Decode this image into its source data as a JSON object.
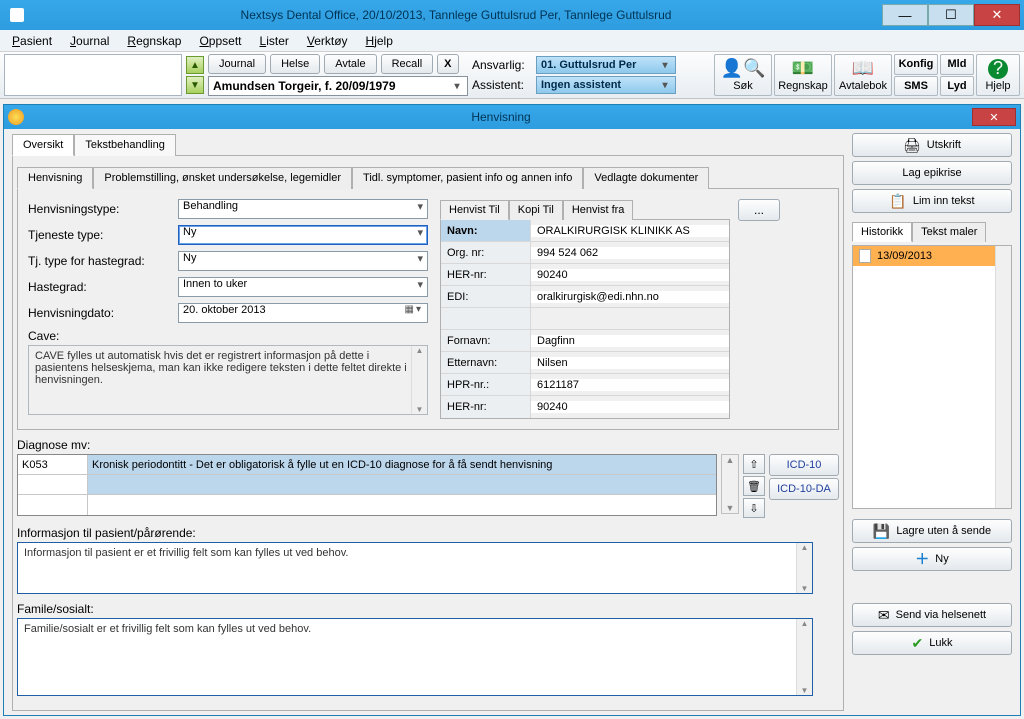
{
  "titlebar": {
    "text": "Nextsys Dental Office,  20/10/2013, Tannlege Guttulsrud Per,  Tannlege Guttulsrud"
  },
  "menubar": {
    "items": [
      "Pasient",
      "Journal",
      "Regnskap",
      "Oppsett",
      "Lister",
      "Verktøy",
      "Hjelp"
    ]
  },
  "toolbar": {
    "buttons": {
      "journal": "Journal",
      "helse": "Helse",
      "avtale": "Avtale",
      "recall": "Recall",
      "x": "X"
    },
    "patient": "Amundsen Torgeir, f. 20/09/1979",
    "ansvarlig_lbl": "Ansvarlig:",
    "ansvarlig": "01. Guttulsrud Per",
    "assistent_lbl": "Assistent:",
    "assistent": "Ingen assistent",
    "big": {
      "sok": "Søk",
      "regnskap": "Regnskap",
      "avtalebok": "Avtalebok",
      "hjelp": "Hjelp"
    },
    "twin": {
      "konfig": "Konfig",
      "sms": "SMS",
      "mld": "Mld",
      "lyd": "Lyd"
    }
  },
  "sub": {
    "title": "Henvisning",
    "tabs1": {
      "oversikt": "Oversikt",
      "tekst": "Tekstbehandling"
    },
    "tabs2": {
      "t1": "Henvisning",
      "t2": "Problemstilling, ønsket undersøkelse, legemidler",
      "t3": "Tidl. symptomer, pasient info og annen info",
      "t4": "Vedlagte dokumenter"
    },
    "form": {
      "henvisningstype_lbl": "Henvisningstype:",
      "henvisningstype": "Behandling",
      "tjeneste_lbl": "Tjeneste type:",
      "tjeneste": "Ny",
      "haste_lbl": "Tj. type for hastegrad:",
      "haste": "Ny",
      "hastegrad_lbl": "Hastegrad:",
      "hastegrad": "Innen to uker",
      "dato_lbl": "Henvisningdato:",
      "dato": "20.   oktober   2013",
      "cave_lbl": "Cave:",
      "cave_text": "CAVE fylles ut automatisk hvis det er registrert informasjon på dette i pasientens helseskjema, man kan ikke redigere teksten i dette feltet direkte i henvisningen."
    },
    "recip": {
      "tabs": {
        "til": "Henvist Til",
        "kopi": "Kopi Til",
        "fra": "Henvist fra"
      },
      "navn_k": "Navn:",
      "navn_v": "ORALKIRURGISK KLINIKK AS",
      "org_k": "Org. nr:",
      "org_v": "994 524 062",
      "her_k": "HER-nr:",
      "her_v": "90240",
      "edi_k": "EDI:",
      "edi_v": "oralkirurgisk@edi.nhn.no",
      "fornavn_k": "Fornavn:",
      "fornavn_v": "Dagfinn",
      "etternavn_k": "Etternavn:",
      "etternavn_v": "Nilsen",
      "hpr_k": "HPR-nr.:",
      "hpr_v": "6121187",
      "her2_k": "HER-nr:",
      "her2_v": "90240",
      "dots": "..."
    },
    "diag": {
      "lbl": "Diagnose mv:",
      "code": "K053",
      "text": "Kronisk periodontitt - Det er obligatorisk å fylle ut en ICD-10 diagnose for å få sendt henvisning",
      "icd10": "ICD-10",
      "icd10da": "ICD-10-DA"
    },
    "info_lbl": "Informasjon til pasient/pårørende:",
    "info_txt": "Informasjon til pasient er et frivillig felt som kan fylles ut ved behov.",
    "fam_lbl": "Famile/sosialt:",
    "fam_txt": "Familie/sosialt er et frivillig felt som kan fylles ut ved behov."
  },
  "right": {
    "utskrift": "Utskrift",
    "epikrise": "Lag epikrise",
    "liminn": "Lim inn tekst",
    "hist_tab": "Historikk",
    "maler_tab": "Tekst maler",
    "hist_item": "13/09/2013",
    "lagre": "Lagre uten å sende",
    "ny": "Ny",
    "send": "Send via helsenett",
    "lukk": "Lukk"
  }
}
